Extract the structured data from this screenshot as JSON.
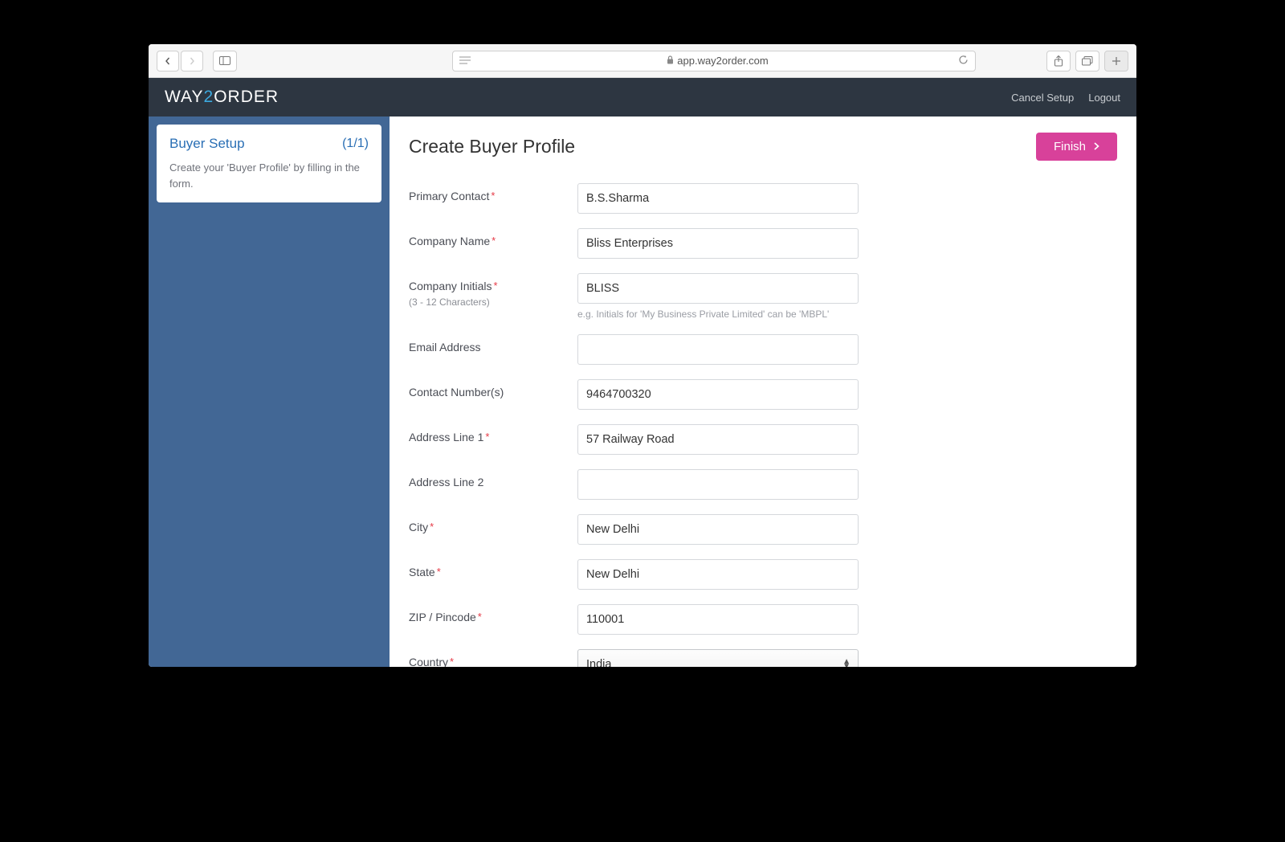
{
  "browser": {
    "url_host": "app.way2order.com"
  },
  "header": {
    "logo_prefix": "WAY",
    "logo_accent": "2",
    "logo_suffix": "ORDER",
    "links": {
      "cancel_setup": "Cancel Setup",
      "logout": "Logout"
    }
  },
  "sidebar": {
    "title": "Buyer Setup",
    "count": "(1/1)",
    "description": "Create your 'Buyer Profile' by filling in the form."
  },
  "main": {
    "title": "Create Buyer Profile",
    "finish_label": "Finish"
  },
  "form": {
    "primary_contact": {
      "label": "Primary Contact",
      "value": "B.S.Sharma",
      "required": true
    },
    "company_name": {
      "label": "Company Name",
      "value": "Bliss Enterprises",
      "required": true
    },
    "company_initials": {
      "label": "Company Initials",
      "sublabel": "(3 - 12 Characters)",
      "value": "BLISS",
      "hint": "e.g. Initials for 'My Business Private Limited' can be 'MBPL'",
      "required": true
    },
    "email": {
      "label": "Email Address",
      "value": ""
    },
    "contact_numbers": {
      "label": "Contact Number(s)",
      "value": "9464700320"
    },
    "address1": {
      "label": "Address Line 1",
      "value": "57 Railway Road",
      "required": true
    },
    "address2": {
      "label": "Address Line 2",
      "value": ""
    },
    "city": {
      "label": "City",
      "value": "New Delhi",
      "required": true
    },
    "state": {
      "label": "State",
      "value": "New Delhi",
      "required": true
    },
    "zip": {
      "label": "ZIP / Pincode",
      "value": "110001",
      "required": true
    },
    "country": {
      "label": "Country",
      "value": "India",
      "required": true
    }
  }
}
